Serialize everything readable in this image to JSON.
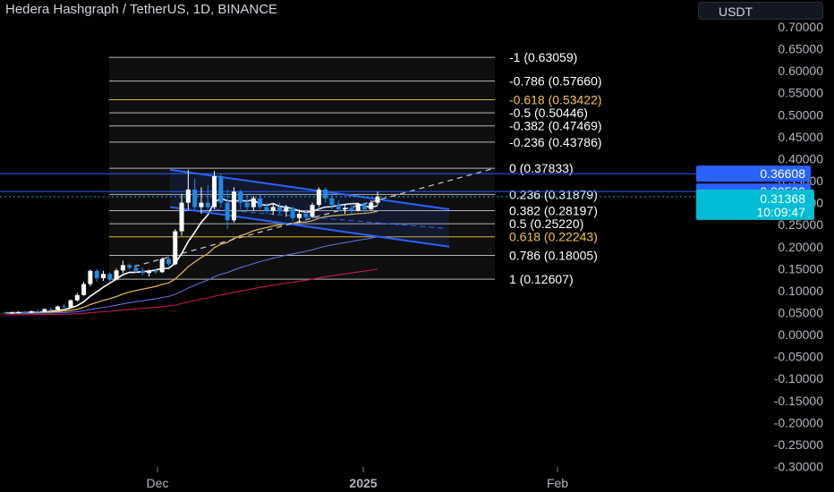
{
  "header": {
    "title": "Hedera Hashgraph / TetherUS, 1D, BINANCE",
    "currency": "USDT"
  },
  "colors": {
    "background": "#000000",
    "up_candle": "#ffffff",
    "down_candle": "#1e88e5",
    "fib_normal": "#ffffff",
    "fib_golden": "#f5c542",
    "channel": "#2962ff",
    "ma_fast": "#ffffff",
    "ma_mid": "#e0b04a",
    "ma_slow": "#5b6ee1",
    "ma_long": "#c2185b",
    "current_price_bg": "#00bcd4",
    "price_label_bg": "#2962ff"
  },
  "chart_data": {
    "type": "candlestick",
    "symbol": "Hedera Hashgraph / TetherUS",
    "interval": "1D",
    "exchange": "BINANCE",
    "ylim": [
      -0.33,
      0.72
    ],
    "y_ticks": [
      "0.70000",
      "0.65000",
      "0.60000",
      "0.55000",
      "0.50000",
      "0.45000",
      "0.40000",
      "0.35000",
      "0.30000",
      "0.25000",
      "0.20000",
      "0.15000",
      "0.10000",
      "0.05000",
      "0.00000",
      "-0.05000",
      "-0.10000",
      "-0.15000",
      "-0.20000",
      "-0.25000",
      "-0.30000"
    ],
    "x_ticks": [
      "Dec",
      "2025",
      "Feb"
    ],
    "fib_levels": [
      {
        "label": "-1 (0.63059)",
        "price": 0.63059,
        "golden": false
      },
      {
        "label": "-0.786 (0.57660)",
        "price": 0.5766,
        "golden": false
      },
      {
        "label": "-0.618 (0.53422)",
        "price": 0.53422,
        "golden": true
      },
      {
        "label": "-0.5 (0.50446)",
        "price": 0.50446,
        "golden": false
      },
      {
        "label": "-0.382 (0.47469)",
        "price": 0.47469,
        "golden": false
      },
      {
        "label": "-0.236 (0.43786)",
        "price": 0.43786,
        "golden": false
      },
      {
        "label": "0 (0.37833)",
        "price": 0.37833,
        "golden": false
      },
      {
        "label": "0.236 (0.31879)",
        "price": 0.31879,
        "golden": false
      },
      {
        "label": "0.382 (0.28197)",
        "price": 0.28197,
        "golden": false
      },
      {
        "label": "0.5 (0.25220)",
        "price": 0.2522,
        "golden": false
      },
      {
        "label": "0.618 (0.22243)",
        "price": 0.22243,
        "golden": true
      },
      {
        "label": "0.786 (0.18005)",
        "price": 0.18005,
        "golden": false
      },
      {
        "label": "1 (0.12607)",
        "price": 0.12607,
        "golden": false
      }
    ],
    "price_labels": [
      {
        "text": "0.36608",
        "price": 0.36608
      },
      {
        "text": "0.32539",
        "price": 0.32539
      }
    ],
    "current_price": {
      "price": "0.31368",
      "countdown": "10:09:47",
      "value": 0.31368
    },
    "candles": [
      {
        "o": 0.05,
        "h": 0.052,
        "l": 0.048,
        "c": 0.049
      },
      {
        "o": 0.049,
        "h": 0.052,
        "l": 0.047,
        "c": 0.05
      },
      {
        "o": 0.05,
        "h": 0.053,
        "l": 0.048,
        "c": 0.051
      },
      {
        "o": 0.051,
        "h": 0.054,
        "l": 0.049,
        "c": 0.05
      },
      {
        "o": 0.05,
        "h": 0.055,
        "l": 0.049,
        "c": 0.053
      },
      {
        "o": 0.053,
        "h": 0.057,
        "l": 0.051,
        "c": 0.052
      },
      {
        "o": 0.052,
        "h": 0.06,
        "l": 0.051,
        "c": 0.058
      },
      {
        "o": 0.058,
        "h": 0.062,
        "l": 0.055,
        "c": 0.057
      },
      {
        "o": 0.057,
        "h": 0.066,
        "l": 0.056,
        "c": 0.064
      },
      {
        "o": 0.064,
        "h": 0.07,
        "l": 0.06,
        "c": 0.062
      },
      {
        "o": 0.062,
        "h": 0.08,
        "l": 0.061,
        "c": 0.078
      },
      {
        "o": 0.078,
        "h": 0.095,
        "l": 0.075,
        "c": 0.09
      },
      {
        "o": 0.09,
        "h": 0.12,
        "l": 0.088,
        "c": 0.115
      },
      {
        "o": 0.115,
        "h": 0.148,
        "l": 0.11,
        "c": 0.145
      },
      {
        "o": 0.145,
        "h": 0.15,
        "l": 0.12,
        "c": 0.128
      },
      {
        "o": 0.128,
        "h": 0.145,
        "l": 0.122,
        "c": 0.138
      },
      {
        "o": 0.138,
        "h": 0.142,
        "l": 0.118,
        "c": 0.125
      },
      {
        "o": 0.125,
        "h": 0.15,
        "l": 0.123,
        "c": 0.146
      },
      {
        "o": 0.146,
        "h": 0.168,
        "l": 0.14,
        "c": 0.158
      },
      {
        "o": 0.158,
        "h": 0.162,
        "l": 0.148,
        "c": 0.152
      },
      {
        "o": 0.152,
        "h": 0.16,
        "l": 0.14,
        "c": 0.145
      },
      {
        "o": 0.145,
        "h": 0.152,
        "l": 0.135,
        "c": 0.14
      },
      {
        "o": 0.14,
        "h": 0.148,
        "l": 0.132,
        "c": 0.144
      },
      {
        "o": 0.144,
        "h": 0.15,
        "l": 0.138,
        "c": 0.142
      },
      {
        "o": 0.142,
        "h": 0.175,
        "l": 0.14,
        "c": 0.172
      },
      {
        "o": 0.172,
        "h": 0.178,
        "l": 0.155,
        "c": 0.16
      },
      {
        "o": 0.16,
        "h": 0.24,
        "l": 0.158,
        "c": 0.235
      },
      {
        "o": 0.235,
        "h": 0.32,
        "l": 0.225,
        "c": 0.3
      },
      {
        "o": 0.3,
        "h": 0.375,
        "l": 0.285,
        "c": 0.33
      },
      {
        "o": 0.33,
        "h": 0.355,
        "l": 0.28,
        "c": 0.29
      },
      {
        "o": 0.29,
        "h": 0.335,
        "l": 0.275,
        "c": 0.3
      },
      {
        "o": 0.3,
        "h": 0.34,
        "l": 0.285,
        "c": 0.29
      },
      {
        "o": 0.29,
        "h": 0.372,
        "l": 0.285,
        "c": 0.36
      },
      {
        "o": 0.36,
        "h": 0.366,
        "l": 0.29,
        "c": 0.3
      },
      {
        "o": 0.3,
        "h": 0.33,
        "l": 0.24,
        "c": 0.26
      },
      {
        "o": 0.26,
        "h": 0.335,
        "l": 0.255,
        "c": 0.325
      },
      {
        "o": 0.325,
        "h": 0.33,
        "l": 0.285,
        "c": 0.3
      },
      {
        "o": 0.3,
        "h": 0.318,
        "l": 0.28,
        "c": 0.29
      },
      {
        "o": 0.29,
        "h": 0.315,
        "l": 0.282,
        "c": 0.31
      },
      {
        "o": 0.31,
        "h": 0.318,
        "l": 0.285,
        "c": 0.29
      },
      {
        "o": 0.29,
        "h": 0.3,
        "l": 0.275,
        "c": 0.282
      },
      {
        "o": 0.282,
        "h": 0.298,
        "l": 0.272,
        "c": 0.29
      },
      {
        "o": 0.29,
        "h": 0.3,
        "l": 0.275,
        "c": 0.28
      },
      {
        "o": 0.28,
        "h": 0.295,
        "l": 0.268,
        "c": 0.288
      },
      {
        "o": 0.288,
        "h": 0.292,
        "l": 0.258,
        "c": 0.265
      },
      {
        "o": 0.265,
        "h": 0.285,
        "l": 0.255,
        "c": 0.275
      },
      {
        "o": 0.275,
        "h": 0.285,
        "l": 0.26,
        "c": 0.268
      },
      {
        "o": 0.268,
        "h": 0.3,
        "l": 0.265,
        "c": 0.295
      },
      {
        "o": 0.295,
        "h": 0.335,
        "l": 0.29,
        "c": 0.33
      },
      {
        "o": 0.33,
        "h": 0.335,
        "l": 0.3,
        "c": 0.31
      },
      {
        "o": 0.31,
        "h": 0.32,
        "l": 0.285,
        "c": 0.295
      },
      {
        "o": 0.295,
        "h": 0.305,
        "l": 0.28,
        "c": 0.285
      },
      {
        "o": 0.285,
        "h": 0.295,
        "l": 0.275,
        "c": 0.288
      },
      {
        "o": 0.288,
        "h": 0.298,
        "l": 0.275,
        "c": 0.282
      },
      {
        "o": 0.282,
        "h": 0.3,
        "l": 0.28,
        "c": 0.296
      },
      {
        "o": 0.296,
        "h": 0.3,
        "l": 0.276,
        "c": 0.285
      },
      {
        "o": 0.285,
        "h": 0.305,
        "l": 0.283,
        "c": 0.3
      },
      {
        "o": 0.3,
        "h": 0.325,
        "l": 0.295,
        "c": 0.314
      }
    ]
  }
}
